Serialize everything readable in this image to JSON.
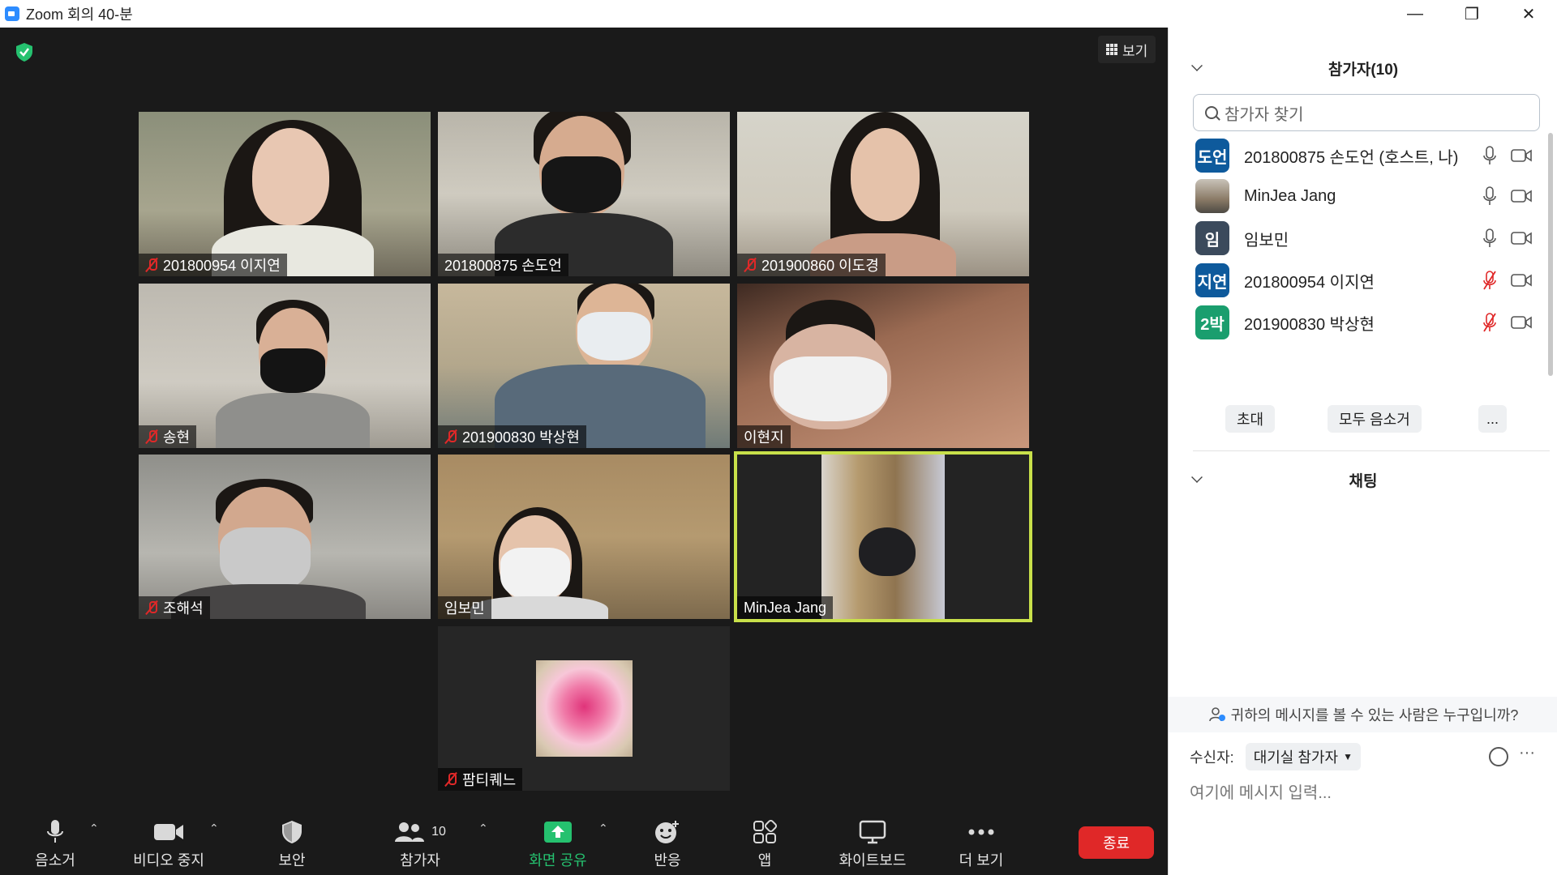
{
  "window": {
    "title": "Zoom 회의 40-분",
    "minimize": "—",
    "restore": "❐",
    "close": "✕"
  },
  "meeting": {
    "view_label": "보기",
    "tiles": [
      {
        "name": "201800954 이지연",
        "muted": true
      },
      {
        "name": "201800875 손도언",
        "muted": false
      },
      {
        "name": "201900860 이도경",
        "muted": true
      },
      {
        "name": "송현",
        "muted": true
      },
      {
        "name": "201900830 박상현",
        "muted": true
      },
      {
        "name": "이현지",
        "muted": false
      },
      {
        "name": "조해석",
        "muted": true
      },
      {
        "name": "임보민",
        "muted": false
      },
      {
        "name": "MinJea Jang",
        "muted": false,
        "active_speaker": true
      },
      {
        "name": "팜티퀘느",
        "muted": true
      }
    ]
  },
  "toolbar": {
    "audio": "음소거",
    "video": "비디오 중지",
    "security": "보안",
    "participants": "참가자",
    "participants_count": "10",
    "share": "화면 공유",
    "reactions": "반응",
    "apps": "앱",
    "whiteboard": "화이트보드",
    "more": "더 보기",
    "end": "종료"
  },
  "sidebar": {
    "participants_title": "참가자(10)",
    "search_placeholder": "참가자 찾기",
    "participants": [
      {
        "initials": "도언",
        "name": "201800875 손도언 (호스트, 나)",
        "color": "#0e5a9c",
        "muted": false
      },
      {
        "initials": "",
        "name": "MinJea Jang",
        "color": "#7a7a7a",
        "muted": false
      },
      {
        "initials": "임",
        "name": "임보민",
        "color": "#3b4a5c",
        "muted": false
      },
      {
        "initials": "지연",
        "name": "201800954 이지연",
        "color": "#0e5a9c",
        "muted": true
      },
      {
        "initials": "2박",
        "name": "201900830 박상현",
        "color": "#1a9e6e",
        "muted": true
      }
    ],
    "invite": "초대",
    "mute_all": "모두 음소거",
    "more": "...",
    "chat_title": "채팅",
    "who_can_see": "귀하의 메시지를 볼 수 있는 사람은 누구입니까?",
    "recipient_label": "수신자:",
    "recipient_value": "대기실 참가자",
    "input_placeholder": "여기에 메시지 입력...",
    "more_dots": "···"
  }
}
